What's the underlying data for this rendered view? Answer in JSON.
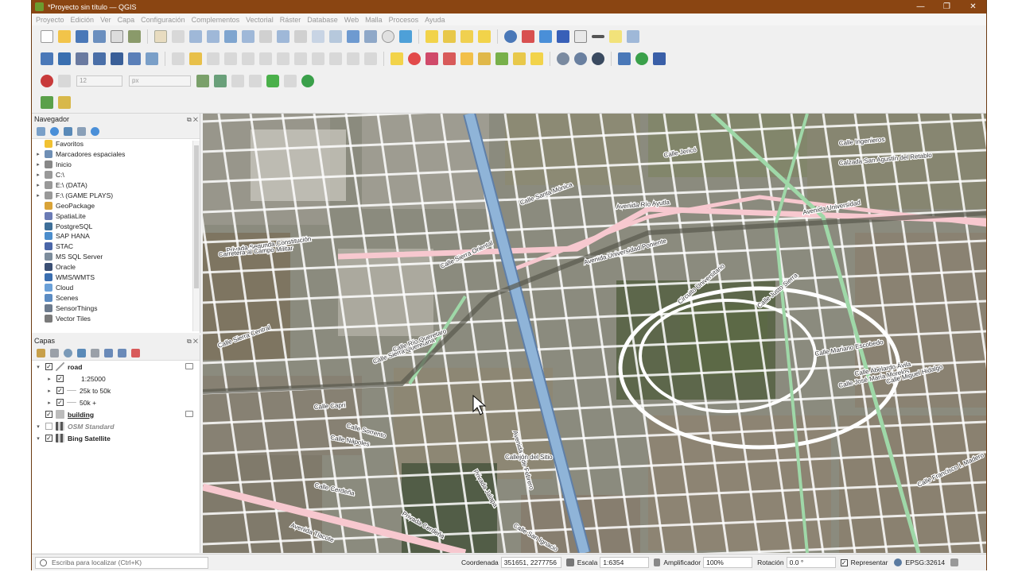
{
  "window": {
    "title": "*Proyecto sin título — QGIS",
    "buttons": [
      "—",
      "❐",
      "✕"
    ]
  },
  "menu": [
    "Proyecto",
    "Edición",
    "Ver",
    "Capa",
    "Configuración",
    "Complementos",
    "Vectorial",
    "Ráster",
    "Database",
    "Web",
    "Malla",
    "Procesos",
    "Ayuda"
  ],
  "digitizing": {
    "font_size": "12",
    "unit": "px"
  },
  "browser": {
    "title": "Navegador",
    "items": [
      {
        "label": "Favoritos",
        "icon": "star-icon",
        "color": "#f1c232",
        "expand": false
      },
      {
        "label": "Marcadores espaciales",
        "icon": "bookmark-icon",
        "color": "#6f8fb5",
        "expand": true
      },
      {
        "label": "Inicio",
        "icon": "folder-icon",
        "color": "#888888",
        "expand": true
      },
      {
        "label": "C:\\",
        "icon": "drive-icon",
        "color": "#999999",
        "expand": true
      },
      {
        "label": "E:\\ (DATA)",
        "icon": "drive-icon",
        "color": "#999999",
        "expand": true
      },
      {
        "label": "F:\\ (GAME PLAYS)",
        "icon": "drive-icon",
        "color": "#999999",
        "expand": true
      },
      {
        "label": "GeoPackage",
        "icon": "geopackage-icon",
        "color": "#d9a338",
        "expand": false
      },
      {
        "label": "SpatiaLite",
        "icon": "spatialite-icon",
        "color": "#6a7bb5",
        "expand": false
      },
      {
        "label": "PostgreSQL",
        "icon": "postgresql-icon",
        "color": "#3e6f99",
        "expand": false
      },
      {
        "label": "SAP HANA",
        "icon": "saphana-icon",
        "color": "#4b8dcc",
        "expand": false
      },
      {
        "label": "STAC",
        "icon": "stac-icon",
        "color": "#4a66a8",
        "expand": false
      },
      {
        "label": "MS SQL Server",
        "icon": "mssql-icon",
        "color": "#7c8c9c",
        "expand": false
      },
      {
        "label": "Oracle",
        "icon": "oracle-icon",
        "color": "#3b4f74",
        "expand": false
      },
      {
        "label": "WMS/WMTS",
        "icon": "wms-icon",
        "color": "#3a6eb0",
        "expand": false
      },
      {
        "label": "Cloud",
        "icon": "cloud-icon",
        "color": "#6aa0d8",
        "expand": false
      },
      {
        "label": "Scenes",
        "icon": "scenes-icon",
        "color": "#5b8bc2",
        "expand": false
      },
      {
        "label": "SensorThings",
        "icon": "sensorthings-icon",
        "color": "#6c7a8c",
        "expand": false
      },
      {
        "label": "Vector Tiles",
        "icon": "vectortiles-icon",
        "color": "#7a7a7a",
        "expand": false
      }
    ]
  },
  "layers": {
    "title": "Capas",
    "items": [
      {
        "label": "road",
        "bold": true,
        "italic": false,
        "checked": true,
        "expand": "▾",
        "indent": 0,
        "icon": "line-layer-icon"
      },
      {
        "label": "1:25000",
        "bold": false,
        "italic": false,
        "checked": true,
        "expand": "▸",
        "indent": 1,
        "icon": "none"
      },
      {
        "label": "25k to 50k",
        "bold": false,
        "italic": false,
        "checked": true,
        "expand": "▸",
        "indent": 1,
        "icon": "line-symbol-icon"
      },
      {
        "label": "50k +",
        "bold": false,
        "italic": false,
        "checked": true,
        "expand": "▸",
        "indent": 1,
        "icon": "line-symbol-icon"
      },
      {
        "label": "building",
        "bold": true,
        "italic": false,
        "checked": true,
        "expand": "",
        "indent": 0,
        "icon": "polygon-layer-icon",
        "underline": true
      },
      {
        "label": "OSM Standard",
        "bold": true,
        "italic": true,
        "checked": false,
        "expand": "▾",
        "indent": 0,
        "icon": "raster-layer-icon"
      },
      {
        "label": "Bing Satellite",
        "bold": true,
        "italic": false,
        "checked": true,
        "expand": "▾",
        "indent": 0,
        "icon": "raster-layer-icon"
      }
    ]
  },
  "map_labels": [
    "Privada Segunda Constitución",
    "Carretera al Campo Militar",
    "Calle Sierra Oriental",
    "Calle Sierra Central",
    "Calle Sierra Queretana",
    "Calle Río Queretaro",
    "Avenida 5 de Febrero",
    "Avenida Universidad Poniente",
    "Circuito Universitario",
    "Avenida Universidad",
    "Calle Justo Sierra",
    "Calle Mariano Escobedo",
    "Calle Abelardo Ávila",
    "Calle José María Morelos",
    "Calle Miguel Hidalgo",
    "Calle Capri",
    "Calle Sorrento",
    "Calle Nápoles",
    "Calle Cerdeña",
    "Privada Cerdeña",
    "Avenida Tlacote",
    "Calle Ingenieros",
    "Calzada San Agustín del Retablo",
    "Calle Santa Mónica",
    "Calle Jericó",
    "Avenida Río Ayutla",
    "Calle Francisco I. Madero",
    "Callejón del Sitio",
    "Privada Jalapa",
    "Calle San Ignacio"
  ],
  "status": {
    "locator_placeholder": "Escriba para localizar (Ctrl+K)",
    "coordinate_label": "Coordenada",
    "coordinate_value": "351651, 2277756",
    "scale_label": "Escala",
    "scale_value": "1:6354",
    "magnifier_label": "Amplificador",
    "magnifier_value": "100%",
    "rotation_label": "Rotación",
    "rotation_value": "0.0 °",
    "render_label": "Representar",
    "crs": "EPSG:32614"
  },
  "colors": {
    "titlebar": "#8a4512",
    "road_major": "#f7c8cf",
    "road_green": "#9fd8a8",
    "road_blue": "#8fb4d8",
    "road_white": "#ffffff",
    "satellite": "#8b8b7e"
  }
}
